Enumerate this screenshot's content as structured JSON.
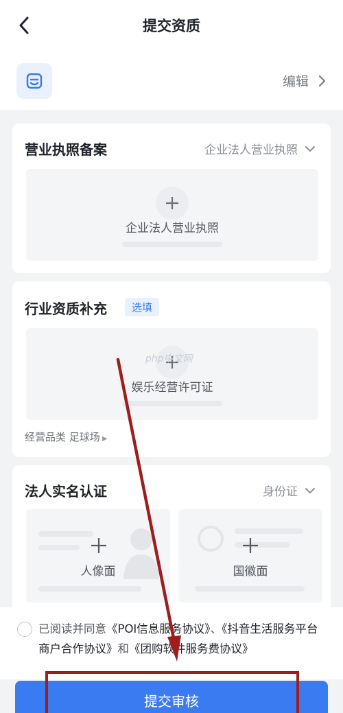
{
  "header": {
    "title": "提交资质"
  },
  "store": {
    "edit_label": "编辑"
  },
  "license": {
    "title": "营业执照备案",
    "type_selected": "企业法人营业执照",
    "upload_label": "企业法人营业执照"
  },
  "industry": {
    "title": "行业资质补充",
    "optional_tag": "选填",
    "upload_label": "娱乐经营许可证",
    "category_label": "经营品类",
    "category_value": "足球场"
  },
  "identity": {
    "title": "法人实名认证",
    "type_selected": "身份证",
    "portrait_label": "人像面",
    "emblem_label": "国徽面"
  },
  "agreement": {
    "prefix": "已阅读并同意",
    "doc1": "《POI信息服务协议》",
    "sep": "、",
    "doc2": "《抖音生活服务平台商户合作协议》",
    "and": "和",
    "doc3": "《团购软件服务费协议》"
  },
  "submit": {
    "label": "提交审核"
  },
  "watermark": "php中文网",
  "colors": {
    "primary": "#3b7bf2",
    "annotation": "#9e1d1d"
  }
}
